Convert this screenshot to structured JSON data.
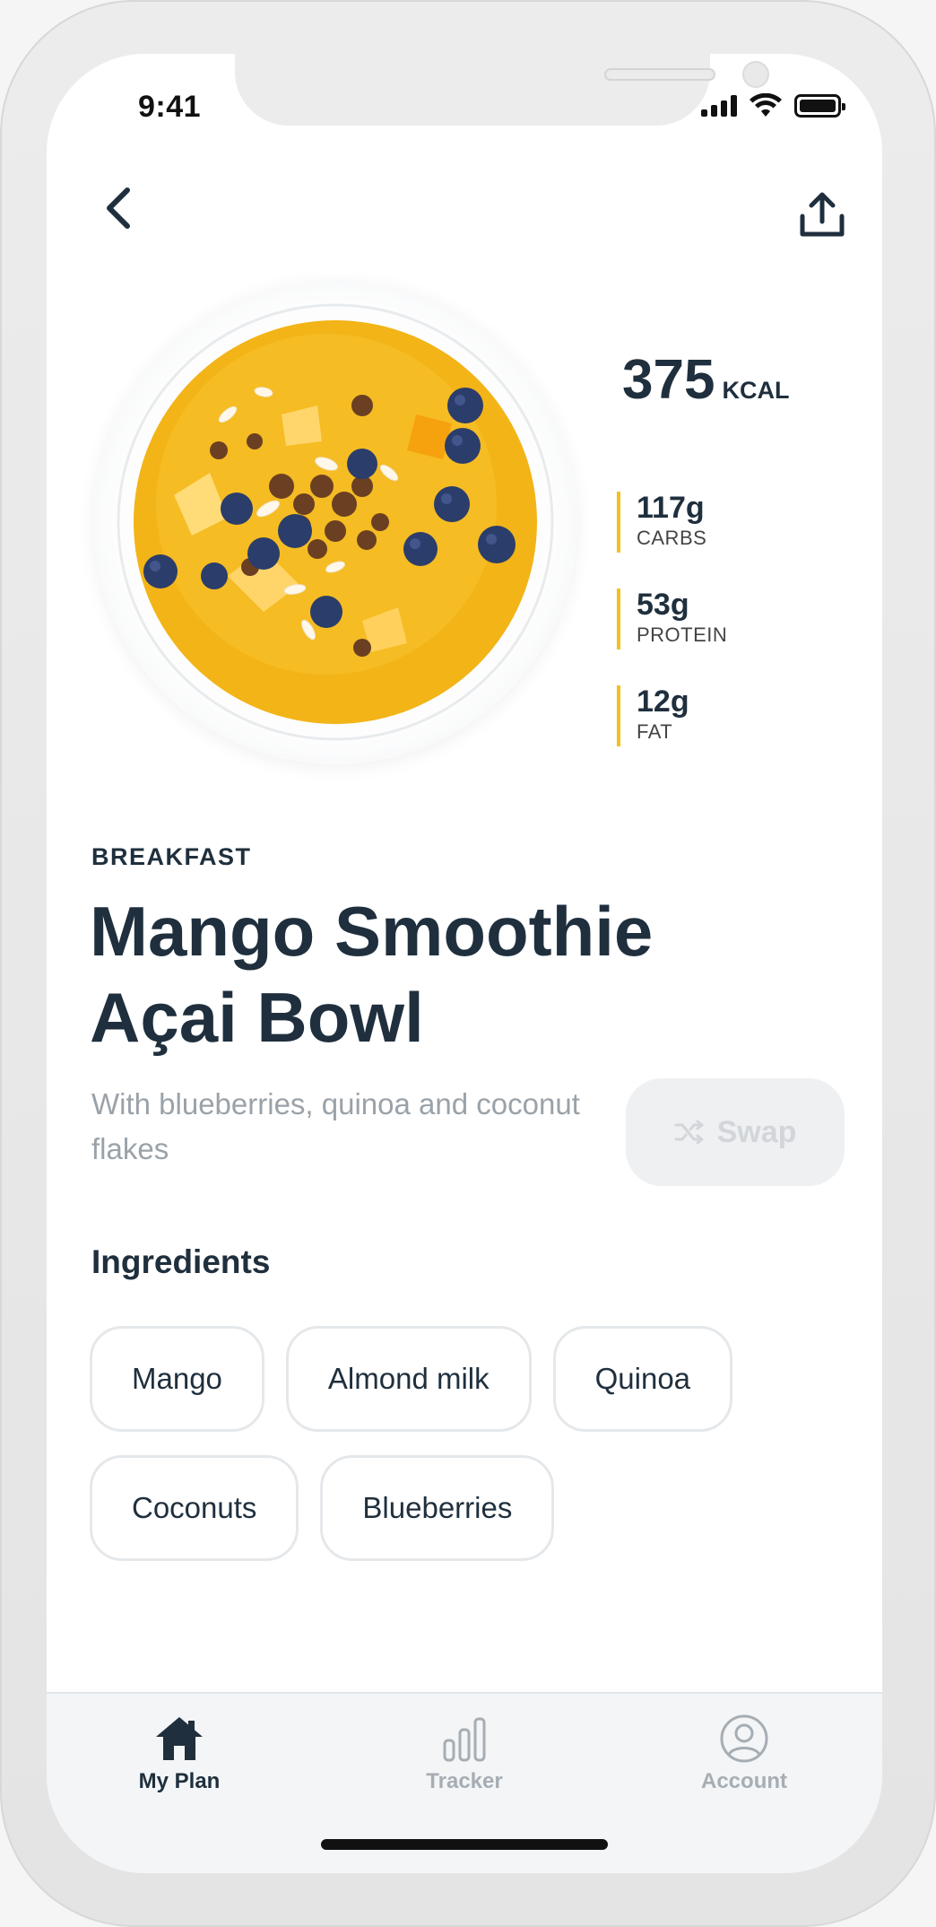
{
  "status_bar": {
    "time": "9:41"
  },
  "nutrition": {
    "kcal_value": "375",
    "kcal_unit": "KCAL",
    "macros": [
      {
        "value": "117g",
        "label": "CARBS"
      },
      {
        "value": "53g",
        "label": "PROTEIN"
      },
      {
        "value": "12g",
        "label": "FAT"
      }
    ]
  },
  "meal": {
    "type": "BREAKFAST",
    "title": "Mango Smoothie Açai Bowl",
    "description": "With blueberries, quinoa and coconut flakes"
  },
  "swap_button": {
    "label": "Swap",
    "icon": "shuffle-icon"
  },
  "ingredients": {
    "title": "Ingredients",
    "items": [
      "Mango",
      "Almond milk",
      "Quinoa",
      "Coconuts",
      "Blueberries"
    ]
  },
  "bottom_nav": {
    "items": [
      {
        "label": "My Plan",
        "icon": "home-icon",
        "active": true
      },
      {
        "label": "Tracker",
        "icon": "bar-chart-icon",
        "active": false
      },
      {
        "label": "Account",
        "icon": "user-circle-icon",
        "active": false
      }
    ]
  },
  "colors": {
    "accent": "#f2c21b",
    "text": "#1f2f3d",
    "muted": "#9aa2a9"
  }
}
